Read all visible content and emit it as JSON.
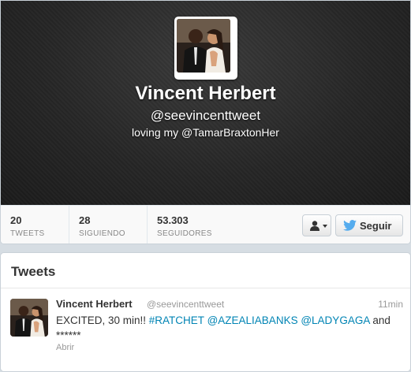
{
  "profile": {
    "name": "Vincent Herbert",
    "handle": "@seevincenttweet",
    "bio": "loving my @TamarBraxtonHer"
  },
  "stats": [
    {
      "value": "20",
      "label": "TWEETS"
    },
    {
      "value": "28",
      "label": "SIGUIENDO"
    },
    {
      "value": "53.303",
      "label": "SEGUIDORES"
    }
  ],
  "actions": {
    "user_menu_icon": "person-icon",
    "follow_label": "Seguir"
  },
  "tweets_section": {
    "title": "Tweets",
    "items": [
      {
        "name": "Vincent Herbert",
        "handle": "@seevincenttweet",
        "time": "11min",
        "text_plain_1": "EXCITED, 30 min!! ",
        "hashtag": "#RATCHET",
        "mention_1": "@AZEALIABANKS",
        "mention_2": "@LADYGAGA",
        "text_plain_2": " and",
        "text_plain_3": "******",
        "open_label": "Abrir"
      }
    ]
  },
  "colors": {
    "link": "#0084b4",
    "header_bg": "#262626",
    "twitter_blue": "#55acee"
  }
}
